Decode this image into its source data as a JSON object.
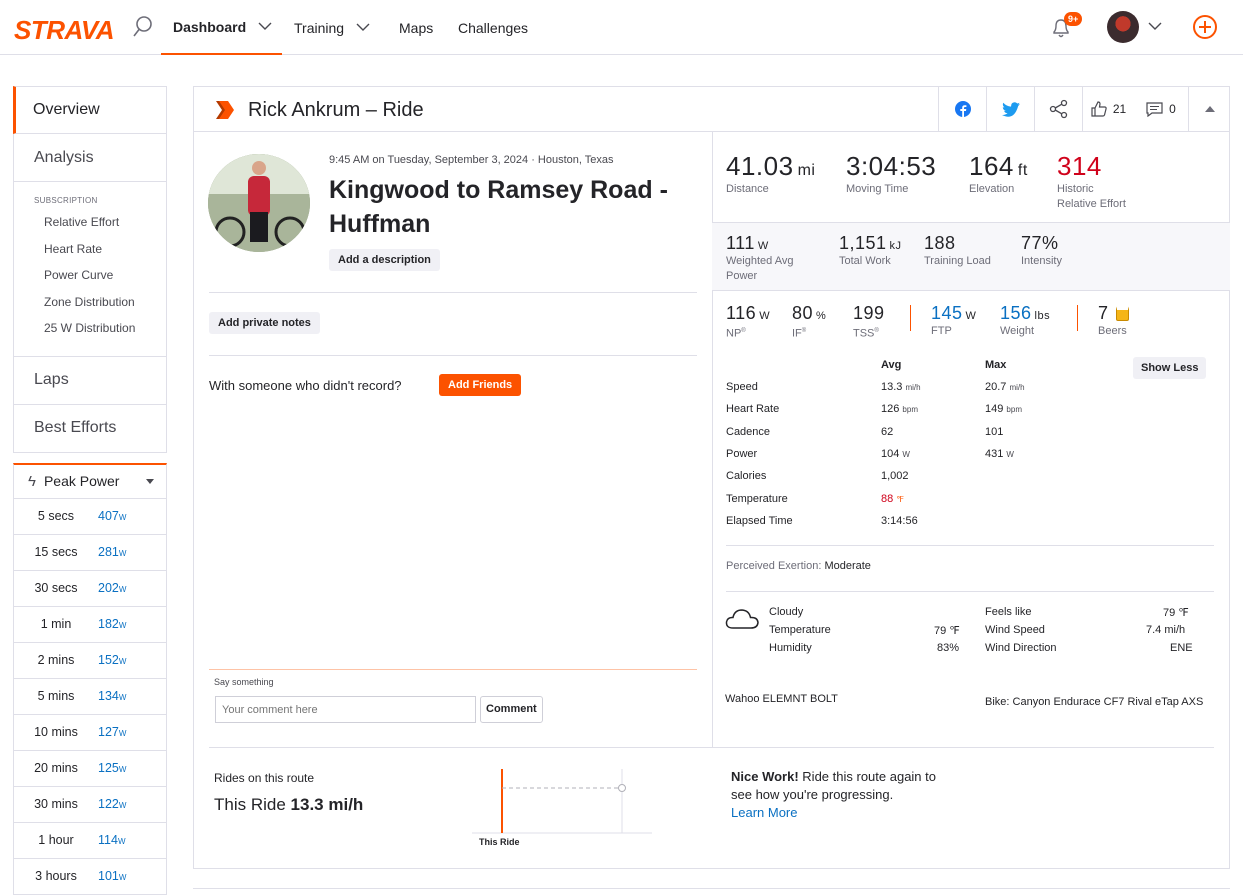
{
  "nav": {
    "logo": "STRAVA",
    "items": [
      {
        "label": "Dashboard"
      },
      {
        "label": "Training"
      },
      {
        "label": "Maps"
      },
      {
        "label": "Challenges"
      }
    ],
    "notification_badge": "9+"
  },
  "sidebar": {
    "overview": "Overview",
    "analysis": "Analysis",
    "subscription_heading": "SUBSCRIPTION",
    "sub_items": [
      "Relative Effort",
      "Heart Rate",
      "Power Curve",
      "Zone Distribution",
      "25 W Distribution"
    ],
    "laps": "Laps",
    "best_efforts": "Best Efforts",
    "peak_power": {
      "title": "Peak Power",
      "unit": "W",
      "rows": [
        {
          "duration": "5 secs",
          "value": "407"
        },
        {
          "duration": "15 secs",
          "value": "281"
        },
        {
          "duration": "30 secs",
          "value": "202"
        },
        {
          "duration": "1 min",
          "value": "182"
        },
        {
          "duration": "2 mins",
          "value": "152"
        },
        {
          "duration": "5 mins",
          "value": "134"
        },
        {
          "duration": "10 mins",
          "value": "127"
        },
        {
          "duration": "20 mins",
          "value": "125"
        },
        {
          "duration": "30 mins",
          "value": "122"
        },
        {
          "duration": "1 hour",
          "value": "114"
        },
        {
          "duration": "3 hours",
          "value": "101"
        }
      ]
    }
  },
  "activity": {
    "header": "Rick Ankrum – Ride",
    "kudos": "21",
    "comments": "0",
    "datetime": "9:45 AM on Tuesday, September 3, 2024 · Houston, Texas",
    "title": "Kingwood to Ramsey Road - Huffman",
    "add_description": "Add a description",
    "add_private_notes": "Add private notes",
    "friends_text": "With someone who didn't record?",
    "add_friends": "Add Friends",
    "say_something": "Say something",
    "comment_placeholder": "Your comment here",
    "comment_button": "Comment"
  },
  "stats": {
    "distance": {
      "value": "41.03",
      "unit": "mi",
      "label": "Distance"
    },
    "moving_time": {
      "value": "3:04:53",
      "label": "Moving Time"
    },
    "elevation": {
      "value": "164",
      "unit": "ft",
      "label": "Elevation"
    },
    "relative_effort": {
      "value": "314",
      "label1": "Historic",
      "label2": "Relative Effort"
    },
    "weighted_power": {
      "value": "111",
      "unit": "W",
      "label1": "Weighted Avg",
      "label2": "Power"
    },
    "total_work": {
      "value": "1,151",
      "unit": "kJ",
      "label": "Total Work"
    },
    "training_load": {
      "value": "188",
      "label": "Training Load"
    },
    "intensity": {
      "value": "77%",
      "label": "Intensity"
    },
    "np": {
      "value": "116",
      "unit": "W",
      "label": "NP",
      "mark": "®"
    },
    "if": {
      "value": "80",
      "unit": "%",
      "label": "IF",
      "mark": "®"
    },
    "tss": {
      "value": "199",
      "label": "TSS",
      "mark": "®"
    },
    "ftp": {
      "value": "145",
      "unit": "W",
      "label": "FTP"
    },
    "weight": {
      "value": "156",
      "unit": "lbs",
      "label": "Weight"
    },
    "beers": {
      "value": "7",
      "label": "Beers"
    }
  },
  "detail_table": {
    "col_avg": "Avg",
    "col_max": "Max",
    "show_less": "Show Less",
    "rows": [
      {
        "label": "Speed",
        "avg": "13.3",
        "avg_unit": "mi/h",
        "max": "20.7",
        "max_unit": "mi/h"
      },
      {
        "label": "Heart Rate",
        "avg": "126",
        "avg_unit": "bpm",
        "max": "149",
        "max_unit": "bpm"
      },
      {
        "label": "Cadence",
        "avg": "62",
        "avg_unit": "",
        "max": "101",
        "max_unit": ""
      },
      {
        "label": "Power",
        "avg": "104",
        "avg_unit": "W",
        "max": "431",
        "max_unit": "W"
      },
      {
        "label": "Calories",
        "avg": "1,002",
        "avg_unit": "",
        "max": "",
        "max_unit": ""
      },
      {
        "label": "Temperature",
        "avg": "88",
        "avg_unit": "℉",
        "max": "",
        "max_unit": ""
      },
      {
        "label": "Elapsed Time",
        "avg": "3:14:56",
        "avg_unit": "",
        "max": "",
        "max_unit": ""
      }
    ],
    "perceived_label": "Perceived Exertion:",
    "perceived_value": "Moderate"
  },
  "weather": {
    "condition": "Cloudy",
    "temperature_label": "Temperature",
    "temperature": "79 ℉",
    "humidity_label": "Humidity",
    "humidity": "83%",
    "feels_like_label": "Feels like",
    "feels_like": "79 ℉",
    "wind_speed_label": "Wind Speed",
    "wind_speed": "7.4 mi/h",
    "wind_dir_label": "Wind Direction",
    "wind_dir": "ENE"
  },
  "devices": {
    "device": "Wahoo ELEMNT BOLT",
    "bike": "Bike: Canyon Endurace CF7 Rival eTap AXS"
  },
  "route": {
    "heading": "Rides on this route",
    "this_ride_label": "This Ride",
    "this_ride_value": "13.3 mi/h",
    "chart_label": "This Ride",
    "nice_work": "Nice Work!",
    "message": "Ride this route again to see how you're progressing.",
    "learn_more": "Learn More"
  },
  "colors": {
    "brand": "#fc5200",
    "link": "#0a70c2"
  }
}
